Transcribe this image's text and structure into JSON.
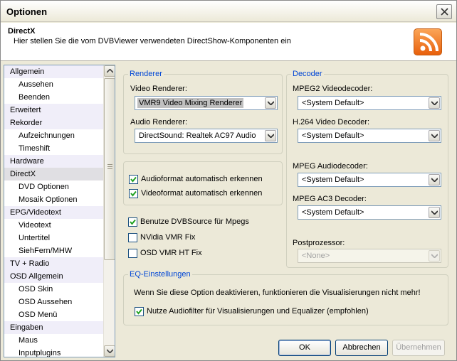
{
  "window": {
    "title": "Optionen"
  },
  "header": {
    "title": "DirectX",
    "subtitle": "Hier stellen Sie die vom DVBViewer verwendeten DirectShow-Komponenten ein"
  },
  "sidebar": {
    "items": [
      {
        "label": "Allgemein",
        "level": 0
      },
      {
        "label": "Aussehen",
        "level": 1
      },
      {
        "label": "Beenden",
        "level": 1
      },
      {
        "label": "Erweitert",
        "level": 0
      },
      {
        "label": "Rekorder",
        "level": 0
      },
      {
        "label": "Aufzeichnungen",
        "level": 1
      },
      {
        "label": "Timeshift",
        "level": 1
      },
      {
        "label": "Hardware",
        "level": 0
      },
      {
        "label": "DirectX",
        "level": 0,
        "selected": true
      },
      {
        "label": "DVD Optionen",
        "level": 1
      },
      {
        "label": "Mosaik Optionen",
        "level": 1
      },
      {
        "label": "EPG/Videotext",
        "level": 0
      },
      {
        "label": "Videotext",
        "level": 1
      },
      {
        "label": "Untertitel",
        "level": 1
      },
      {
        "label": "SiehFern/MHW",
        "level": 1
      },
      {
        "label": "TV + Radio",
        "level": 0
      },
      {
        "label": "OSD Allgemein",
        "level": 0
      },
      {
        "label": "OSD Skin",
        "level": 1
      },
      {
        "label": "OSD Aussehen",
        "level": 1
      },
      {
        "label": "OSD Menü",
        "level": 1
      },
      {
        "label": "Eingaben",
        "level": 0
      },
      {
        "label": "Maus",
        "level": 1
      },
      {
        "label": "Inputplugins",
        "level": 1
      }
    ]
  },
  "renderer": {
    "group_title": "Renderer",
    "video_label": "Video Renderer:",
    "video_value": "VMR9 Video Mixing Renderer",
    "audio_label": "Audio Renderer:",
    "audio_value": "DirectSound: Realtek AC97 Audio"
  },
  "format_options": {
    "audio_auto": {
      "label": "Audioformat automatisch erkennen",
      "checked": true
    },
    "video_auto": {
      "label": "Videoformat automatisch erkennen",
      "checked": true
    }
  },
  "misc_options": {
    "dvbsource": {
      "label": "Benutze DVBSource für Mpegs",
      "checked": true
    },
    "nvidia_fix": {
      "label": "NVidia VMR Fix",
      "checked": false
    },
    "osd_fix": {
      "label": "OSD VMR HT Fix",
      "checked": false
    }
  },
  "decoder": {
    "group_title": "Decoder",
    "mpeg2_label": "MPEG2 Videodecoder:",
    "mpeg2_value": "<System Default>",
    "h264_label": "H.264 Video Decoder:",
    "h264_value": "<System Default>",
    "audio_label": "MPEG Audiodecoder:",
    "audio_value": "<System Default>",
    "ac3_label": "MPEG AC3 Decoder:",
    "ac3_value": "<System Default>",
    "post_label": "Postprozessor:",
    "post_value": "<None>"
  },
  "eq": {
    "group_title": "EQ-Einstellungen",
    "info": "Wenn Sie diese Option deaktivieren, funktionieren die Visualisierungen nicht mehr!",
    "audiofilter": {
      "label": "Nutze Audiofilter für Visualisierungen und Equalizer (empfohlen)",
      "checked": true
    }
  },
  "buttons": {
    "ok": "OK",
    "cancel": "Abbrechen",
    "apply": "Übernehmen"
  },
  "colors": {
    "group_title": "#0046d5",
    "rss_orange": "#f07a1e",
    "window_bg": "#ece9d8"
  },
  "icons": {
    "close": "close-icon",
    "rss": "rss-feed-icon",
    "check": "checkmark-icon",
    "dropdown": "chevron-down-icon"
  }
}
